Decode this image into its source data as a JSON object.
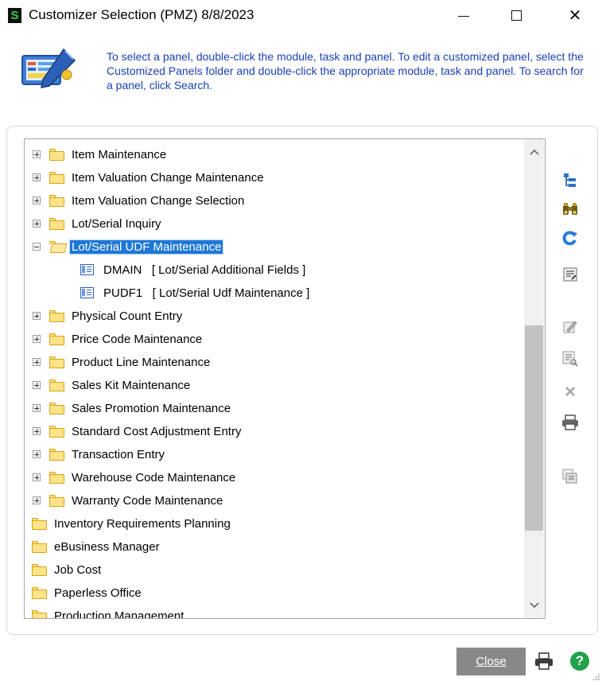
{
  "window": {
    "app_icon": "S",
    "title": "Customizer Selection (PMZ) 8/8/2023",
    "minimize_icon": "minimize-icon",
    "maximize_icon": "maximize-icon",
    "close_glyph": "✕"
  },
  "info": {
    "icon": "customizer-icon",
    "text": "To select a panel, double-click the module, task and panel. To edit a customized panel, select the Customized Panels folder and double-click the appropriate module, task and panel. To search for a panel, click Search."
  },
  "tree": {
    "items": [
      {
        "label": "Item Maintenance",
        "type": "folder",
        "expander": "plus"
      },
      {
        "label": "Item Valuation Change Maintenance",
        "type": "folder",
        "expander": "plus"
      },
      {
        "label": "Item Valuation Change Selection",
        "type": "folder",
        "expander": "plus"
      },
      {
        "label": "Lot/Serial Inquiry",
        "type": "folder",
        "expander": "plus"
      },
      {
        "label": "Lot/Serial UDF Maintenance",
        "type": "folder-open",
        "expander": "minus",
        "selected": true
      },
      {
        "label": "DMAIN   [ Lot/Serial Additional Fields ]",
        "type": "panel"
      },
      {
        "label": "PUDF1   [ Lot/Serial Udf Maintenance ]",
        "type": "panel"
      },
      {
        "label": "Physical Count Entry",
        "type": "folder",
        "expander": "plus"
      },
      {
        "label": "Price Code Maintenance",
        "type": "folder",
        "expander": "plus"
      },
      {
        "label": "Product Line Maintenance",
        "type": "folder",
        "expander": "plus"
      },
      {
        "label": "Sales Kit Maintenance",
        "type": "folder",
        "expander": "plus"
      },
      {
        "label": "Sales Promotion Maintenance",
        "type": "folder",
        "expander": "plus"
      },
      {
        "label": "Standard Cost Adjustment Entry",
        "type": "folder",
        "expander": "plus"
      },
      {
        "label": "Transaction Entry",
        "type": "folder",
        "expander": "plus"
      },
      {
        "label": "Warehouse Code Maintenance",
        "type": "folder",
        "expander": "plus"
      },
      {
        "label": "Warranty Code Maintenance",
        "type": "folder",
        "expander": "plus"
      },
      {
        "label": "Inventory Requirements Planning",
        "type": "folder"
      },
      {
        "label": "eBusiness Manager",
        "type": "folder"
      },
      {
        "label": "Job Cost",
        "type": "folder"
      },
      {
        "label": "Paperless Office",
        "type": "folder"
      },
      {
        "label": "Production Management",
        "type": "folder"
      }
    ]
  },
  "toolbar_icons": [
    "tree-view-icon",
    "search-binoculars-icon",
    "refresh-icon",
    "properties-icon",
    "edit-panel-icon",
    "preview-icon",
    "delete-icon",
    "print-icon",
    "copy-panel-icon"
  ],
  "footer": {
    "close_label": "Close",
    "print_icon": "print-icon",
    "help_icon": "help-icon",
    "help_glyph": "?"
  },
  "colors": {
    "info_text": "#1a3fb5",
    "selection": "#1e78d8",
    "folder": "#ffe388"
  }
}
